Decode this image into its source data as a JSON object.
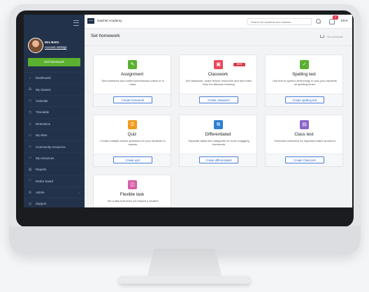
{
  "school": {
    "name": "Satchel Academy",
    "logo_text": "satchel"
  },
  "user": {
    "name": "Mrs Betts",
    "account_link": "Account settings"
  },
  "sidebar": {
    "set_homework_button": "Set homework",
    "items": [
      {
        "label": "Dashboard",
        "icon": "○"
      },
      {
        "label": "My classes",
        "icon": "⁂"
      },
      {
        "label": "Calendar",
        "icon": "▭"
      },
      {
        "label": "Timetable",
        "icon": "◷"
      },
      {
        "label": "Detentions",
        "icon": "△"
      },
      {
        "label": "My drive",
        "icon": "▭"
      },
      {
        "label": "Community resources",
        "icon": "◇"
      },
      {
        "label": "My resources",
        "icon": "▱"
      },
      {
        "label": "Reports",
        "icon": "▤"
      },
      {
        "label": "Notice board",
        "icon": "⚐"
      },
      {
        "label": "Admin",
        "icon": "⚙",
        "chevron": "⌄"
      },
      {
        "label": "Support",
        "icon": "◎"
      }
    ]
  },
  "topbar": {
    "search_placeholder": "Search for students and classes",
    "notification_count": "2",
    "language": "EN ▾"
  },
  "page": {
    "title": "Set homework",
    "breadcrumb": "Set homework"
  },
  "cards": [
    {
      "title": "Assignment",
      "description": "Set homework and collect submissions online or in class",
      "button": "Create homework",
      "icon_color": "#5cb030",
      "icon": "✎"
    },
    {
      "title": "Classwork",
      "description": "Set classwork, share lesson resources and add video links for distance learning",
      "button": "Create classwork",
      "icon_color": "#e8475d",
      "icon": "▣",
      "badge": "NEW"
    },
    {
      "title": "Spelling test",
      "description": "Use text-to-speech technology to quiz your students on spelling terms",
      "button": "Create spelling test",
      "icon_color": "#5cb030",
      "icon": "✓"
    },
    {
      "title": "Quiz",
      "description": "Create multiple-choice questions for your students to answer",
      "button": "Create quiz",
      "icon_color": "#f29a1d",
      "icon": "☰"
    },
    {
      "title": "Differentiated",
      "description": "Separate tasks into categories for more engaging homework",
      "button": "Create differentiated",
      "icon_color": "#2d7fd3",
      "icon": "⧉"
    },
    {
      "title": "Class test",
      "description": "Schedule reminders for important dates at school",
      "button": "Create Class test",
      "icon_color": "#8a63c9",
      "icon": "▤"
    },
    {
      "title": "Flexible task",
      "description": "Set a task that does not require a student",
      "icon_color": "#d65fa7",
      "icon": "◫"
    }
  ]
}
